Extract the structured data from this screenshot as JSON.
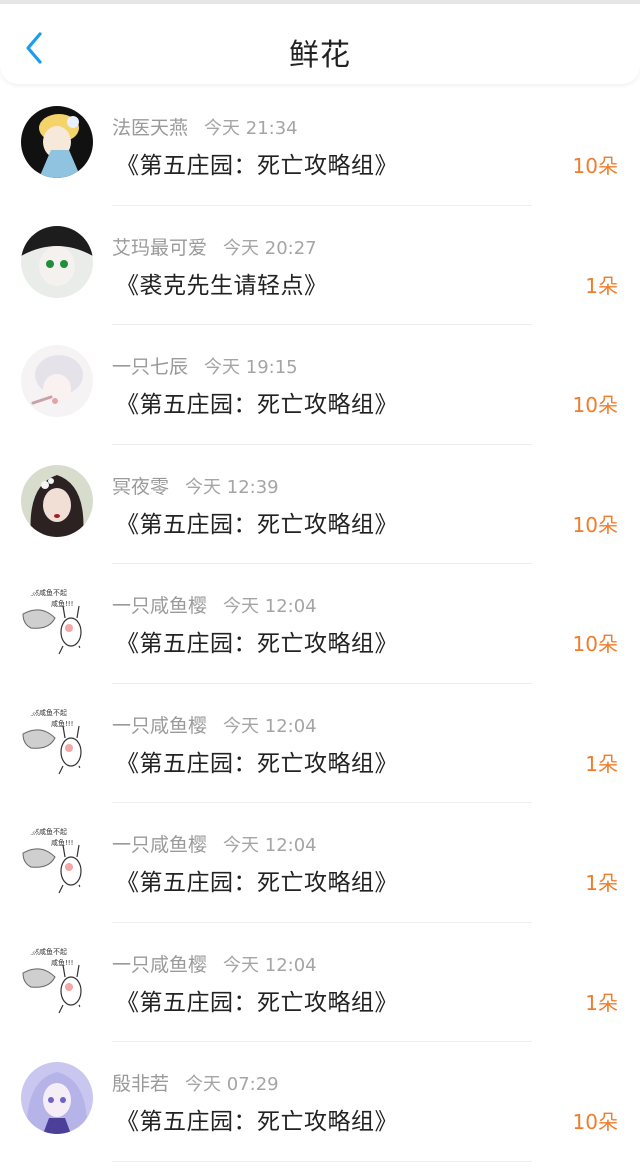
{
  "header": {
    "title": "鲜花",
    "back_icon": "chevron-left-icon",
    "accent_color": "#1a9cf0"
  },
  "flower_color": "#f07d2c",
  "rows": [
    {
      "user": "法医天燕",
      "time": "今天 21:34",
      "book": "《第五庄园：死亡攻略组》",
      "count": "10朵"
    },
    {
      "user": "艾玛最可爱",
      "time": "今天 20:27",
      "book": "《裘克先生请轻点》",
      "count": "1朵"
    },
    {
      "user": "一只七辰",
      "time": "今天 19:15",
      "book": "《第五庄园：死亡攻略组》",
      "count": "10朵"
    },
    {
      "user": "冥夜零",
      "time": "今天 12:39",
      "book": "《第五庄园：死亡攻略组》",
      "count": "10朵"
    },
    {
      "user": "一只咸鱼樱",
      "time": "今天 12:04",
      "book": "《第五庄园：死亡攻略组》",
      "count": "10朵"
    },
    {
      "user": "一只咸鱼樱",
      "time": "今天 12:04",
      "book": "《第五庄园：死亡攻略组》",
      "count": "1朵"
    },
    {
      "user": "一只咸鱼樱",
      "time": "今天 12:04",
      "book": "《第五庄园：死亡攻略组》",
      "count": "1朵"
    },
    {
      "user": "一只咸鱼樱",
      "time": "今天 12:04",
      "book": "《第五庄园：死亡攻略组》",
      "count": "1朵"
    },
    {
      "user": "殷非若",
      "time": "今天 07:29",
      "book": "《第五庄园：死亡攻略组》",
      "count": "10朵"
    }
  ]
}
